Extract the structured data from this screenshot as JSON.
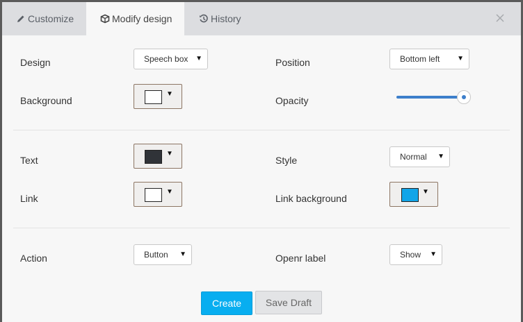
{
  "tabs": [
    {
      "label": "Customize",
      "icon": "pencil-icon",
      "active": false
    },
    {
      "label": "Modify design",
      "icon": "cube-icon",
      "active": true
    },
    {
      "label": "History",
      "icon": "history-icon",
      "active": false
    }
  ],
  "fields": {
    "design": {
      "label": "Design",
      "value": "Speech box"
    },
    "position": {
      "label": "Position",
      "value": "Bottom left"
    },
    "background": {
      "label": "Background",
      "color": "#ffffff"
    },
    "opacity": {
      "label": "Opacity",
      "value": 1.0
    },
    "text": {
      "label": "Text",
      "color": "#303338"
    },
    "style": {
      "label": "Style",
      "value": "Normal"
    },
    "link": {
      "label": "Link",
      "color": "#ffffff"
    },
    "link_background": {
      "label": "Link background",
      "color": "#12a5e8"
    },
    "action": {
      "label": "Action",
      "value": "Button"
    },
    "openr_label": {
      "label": "Openr label",
      "value": "Show"
    }
  },
  "buttons": {
    "create": "Create",
    "save_draft": "Save Draft"
  },
  "colors": {
    "accent": "#08aef0",
    "slider": "#3d7fcb"
  }
}
